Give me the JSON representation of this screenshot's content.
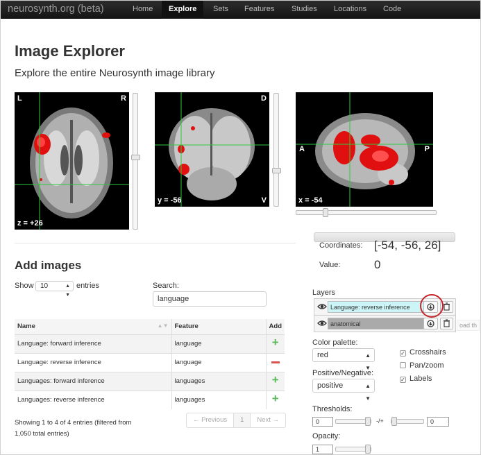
{
  "navbar": {
    "brand": "neurosynth.org (beta)",
    "items": [
      {
        "label": "Home",
        "active": false
      },
      {
        "label": "Explore",
        "active": true
      },
      {
        "label": "Sets",
        "active": false
      },
      {
        "label": "Features",
        "active": false
      },
      {
        "label": "Studies",
        "active": false
      },
      {
        "label": "Locations",
        "active": false
      },
      {
        "label": "Code",
        "active": false
      }
    ]
  },
  "page": {
    "title": "Image Explorer",
    "subtitle": "Explore the entire Neurosynth image library"
  },
  "viewer": {
    "axial": {
      "left": "L",
      "right": "R",
      "coord": "z = +26"
    },
    "coronal": {
      "top": "D",
      "bottom": "V",
      "coord": "y = -56"
    },
    "sagittal": {
      "left": "A",
      "right": "P",
      "coord": "x = -54"
    }
  },
  "add_images": {
    "title": "Add images",
    "show_label": "Show",
    "page_size": "10",
    "entries_label": "entries",
    "search_label": "Search:",
    "search_value": "language",
    "columns": {
      "name": "Name",
      "feature": "Feature",
      "add": "Add"
    },
    "rows": [
      {
        "name": "Language: forward inference",
        "feature": "language",
        "action": "add"
      },
      {
        "name": "Language: reverse inference",
        "feature": "language",
        "action": "remove"
      },
      {
        "name": "Languages: forward inference",
        "feature": "languages",
        "action": "add"
      },
      {
        "name": "Languages: reverse inference",
        "feature": "languages",
        "action": "add"
      }
    ],
    "showing_text": "Showing 1 to 4 of 4 entries (filtered from 1,050 total entries)",
    "pager": {
      "previous": "← Previous",
      "current": "1",
      "next": "Next →"
    }
  },
  "info": {
    "coordinates_label": "Coordinates:",
    "coordinates_value": "[-54, -56, 26]",
    "value_label": "Value:",
    "value": "0"
  },
  "layers": {
    "label": "Layers",
    "items": [
      {
        "name": "Language: reverse inference"
      },
      {
        "name": "anatomical"
      }
    ],
    "tooltip_fragment": "oad th"
  },
  "settings": {
    "palette_label": "Color palette:",
    "palette_value": "red",
    "posneg_label": "Positive/Negative:",
    "posneg_value": "positive",
    "crosshairs_label": "Crosshairs",
    "crosshairs_checked": true,
    "panzoom_label": "Pan/zoom",
    "panzoom_checked": false,
    "labels_label": "Labels",
    "labels_checked": true,
    "thresholds_label": "Thresholds:",
    "threshold_min": "0",
    "threshold_sep": "-/+",
    "threshold_max": "0",
    "opacity_label": "Opacity:",
    "opacity_value": "1"
  },
  "colors": {
    "activation": "#e01010",
    "crosshair": "#2ecc40",
    "highlight": "#c8242b"
  }
}
